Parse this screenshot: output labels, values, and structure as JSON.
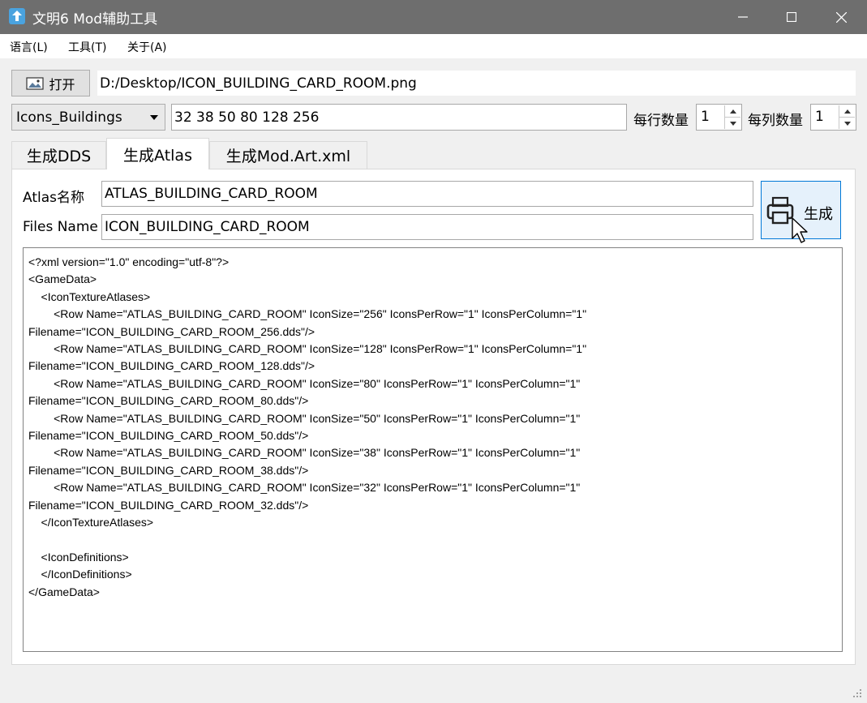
{
  "window": {
    "title": "文明6 Mod辅助工具"
  },
  "menu": {
    "items": [
      {
        "label": "语言(L)"
      },
      {
        "label": "工具(T)"
      },
      {
        "label": "关于(A)"
      }
    ]
  },
  "toolbar": {
    "open_label": "打开",
    "file_path": "D:/Desktop/ICON_BUILDING_CARD_ROOM.png"
  },
  "options": {
    "category_selected": "Icons_Buildings",
    "sizes_value": "32 38 50 80 128 256",
    "per_row_label": "每行数量",
    "per_row_value": "1",
    "per_column_label": "每列数量",
    "per_column_value": "1"
  },
  "tabs": [
    {
      "label": "生成DDS",
      "active": false
    },
    {
      "label": "生成Atlas",
      "active": true
    },
    {
      "label": "生成Mod.Art.xml",
      "active": false
    }
  ],
  "atlas_panel": {
    "atlas_name_label": "Atlas名称",
    "atlas_name_value": "ATLAS_BUILDING_CARD_ROOM",
    "files_name_label": "Files Name",
    "files_name_value": "ICON_BUILDING_CARD_ROOM",
    "generate_label": "生成",
    "xml_output": "<?xml version=\"1.0\" encoding=\"utf-8\"?>\n<GameData>\n    <IconTextureAtlases>\n        <Row Name=\"ATLAS_BUILDING_CARD_ROOM\" IconSize=\"256\" IconsPerRow=\"1\" IconsPerColumn=\"1\"\nFilename=\"ICON_BUILDING_CARD_ROOM_256.dds\"/>\n        <Row Name=\"ATLAS_BUILDING_CARD_ROOM\" IconSize=\"128\" IconsPerRow=\"1\" IconsPerColumn=\"1\"\nFilename=\"ICON_BUILDING_CARD_ROOM_128.dds\"/>\n        <Row Name=\"ATLAS_BUILDING_CARD_ROOM\" IconSize=\"80\" IconsPerRow=\"1\" IconsPerColumn=\"1\"\nFilename=\"ICON_BUILDING_CARD_ROOM_80.dds\"/>\n        <Row Name=\"ATLAS_BUILDING_CARD_ROOM\" IconSize=\"50\" IconsPerRow=\"1\" IconsPerColumn=\"1\"\nFilename=\"ICON_BUILDING_CARD_ROOM_50.dds\"/>\n        <Row Name=\"ATLAS_BUILDING_CARD_ROOM\" IconSize=\"38\" IconsPerRow=\"1\" IconsPerColumn=\"1\"\nFilename=\"ICON_BUILDING_CARD_ROOM_38.dds\"/>\n        <Row Name=\"ATLAS_BUILDING_CARD_ROOM\" IconSize=\"32\" IconsPerRow=\"1\" IconsPerColumn=\"1\"\nFilename=\"ICON_BUILDING_CARD_ROOM_32.dds\"/>\n    </IconTextureAtlases>\n\n    <IconDefinitions>\n    </IconDefinitions>\n</GameData>"
  },
  "icons": {
    "app": "app-icon",
    "open": "image-icon",
    "generate": "printer-icon",
    "cursor": "mouse-pointer-icon"
  },
  "colors": {
    "titlebar": "#6e6e6e",
    "accent": "#0078d7",
    "window_bg": "#f0f0f0"
  }
}
